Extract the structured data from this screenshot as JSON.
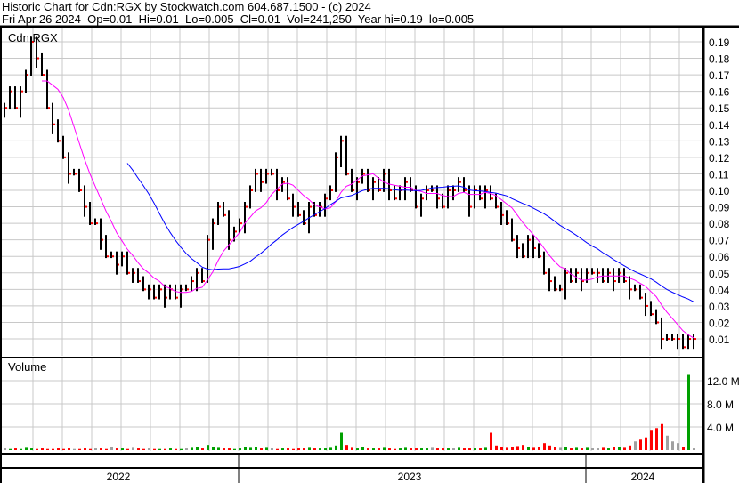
{
  "header": {
    "title": "Historic Chart for Cdn:RGX by Stockwatch.com 604.687.1500 - (c) 2024",
    "quote": "Fri Apr 26 2024  Op=0.01  Hi=0.01  Lo=0.005  Cl=0.01  Vol=241,250  Year hi=0.19  lo=0.005"
  },
  "colors": {
    "up": "#00a000",
    "down": "#ff0000",
    "flat": "#a0a0a0",
    "ma_short": "#ff00ff",
    "ma_long": "#0000ff",
    "grid": "#c8c8c8"
  },
  "chart_data": [
    {
      "type": "line",
      "title": "Cdn:RGX",
      "ylim": [
        0,
        0.195
      ],
      "yticks": [
        "0.19",
        "0.18",
        "0.17",
        "0.16",
        "0.15",
        "0.14",
        "0.13",
        "0.12",
        "0.11",
        "0.10",
        "0.09",
        "0.08",
        "0.07",
        "0.06",
        "0.05",
        "0.04",
        "0.03",
        "0.02",
        "0.01"
      ],
      "ma_periods": [
        8,
        24
      ],
      "close": [
        0.15,
        0.16,
        0.15,
        0.16,
        0.17,
        0.19,
        0.18,
        0.17,
        0.15,
        0.14,
        0.13,
        0.12,
        0.11,
        0.11,
        0.1,
        0.09,
        0.08,
        0.08,
        0.07,
        0.06,
        0.06,
        0.055,
        0.06,
        0.05,
        0.05,
        0.045,
        0.04,
        0.04,
        0.035,
        0.04,
        0.035,
        0.04,
        0.035,
        0.04,
        0.04,
        0.045,
        0.05,
        0.045,
        0.07,
        0.08,
        0.09,
        0.085,
        0.07,
        0.075,
        0.08,
        0.09,
        0.1,
        0.11,
        0.105,
        0.11,
        0.11,
        0.1,
        0.105,
        0.095,
        0.09,
        0.085,
        0.08,
        0.09,
        0.085,
        0.09,
        0.095,
        0.1,
        0.12,
        0.13,
        0.11,
        0.1,
        0.105,
        0.11,
        0.1,
        0.105,
        0.1,
        0.11,
        0.1,
        0.095,
        0.1,
        0.105,
        0.1,
        0.09,
        0.095,
        0.1,
        0.1,
        0.095,
        0.09,
        0.1,
        0.1,
        0.105,
        0.1,
        0.09,
        0.1,
        0.095,
        0.1,
        0.095,
        0.09,
        0.085,
        0.08,
        0.07,
        0.065,
        0.06,
        0.07,
        0.065,
        0.06,
        0.05,
        0.045,
        0.04,
        0.04,
        0.05,
        0.045,
        0.05,
        0.045,
        0.05,
        0.05,
        0.05,
        0.045,
        0.05,
        0.045,
        0.05,
        0.045,
        0.04,
        0.04,
        0.035,
        0.03,
        0.025,
        0.02,
        0.01,
        0.01,
        0.01,
        0.01,
        0.005,
        0.01,
        0.01
      ]
    },
    {
      "type": "bar",
      "title": "Volume",
      "ylim": [
        0,
        14
      ],
      "yticks": [
        "12.0 M",
        "8.0 M",
        "4.0 M"
      ],
      "tick_values": [
        12,
        8,
        4
      ],
      "values": [
        0.3,
        0.2,
        0.3,
        0.2,
        0.4,
        0.3,
        0.2,
        0.3,
        0.2,
        0.2,
        0.3,
        0.2,
        0.3,
        0.2,
        0.2,
        0.3,
        0.2,
        0.3,
        0.3,
        0.2,
        0.5,
        0.3,
        0.3,
        0.2,
        0.4,
        0.3,
        0.2,
        0.3,
        0.2,
        0.2,
        0.2,
        0.3,
        0.2,
        0.2,
        0.3,
        0.4,
        0.5,
        0.3,
        0.9,
        0.6,
        0.4,
        0.3,
        0.3,
        0.2,
        0.3,
        0.6,
        0.4,
        0.5,
        0.3,
        0.4,
        0.3,
        0.2,
        0.3,
        0.3,
        0.2,
        0.3,
        0.3,
        0.4,
        0.3,
        0.3,
        0.3,
        0.4,
        0.8,
        3.0,
        0.9,
        0.4,
        0.3,
        0.5,
        0.3,
        0.3,
        0.3,
        0.4,
        0.3,
        0.2,
        0.3,
        0.4,
        0.3,
        0.3,
        0.3,
        0.3,
        0.4,
        0.3,
        0.3,
        0.3,
        0.3,
        0.4,
        0.3,
        0.3,
        0.3,
        0.3,
        0.4,
        3.0,
        0.8,
        0.5,
        0.4,
        0.6,
        0.7,
        0.9,
        0.5,
        0.4,
        0.6,
        1.2,
        0.8,
        0.6,
        0.4,
        0.5,
        0.3,
        0.4,
        0.3,
        0.4,
        0.3,
        0.3,
        0.4,
        0.3,
        0.5,
        0.6,
        0.4,
        0.8,
        1.5,
        1.8,
        2.2,
        3.5,
        3.8,
        4.5,
        2.5,
        1.5,
        1.2,
        0.6,
        13.0,
        0.3
      ]
    },
    {
      "type": "table",
      "x_labels": [
        "2022",
        "2023",
        "2024"
      ]
    }
  ]
}
